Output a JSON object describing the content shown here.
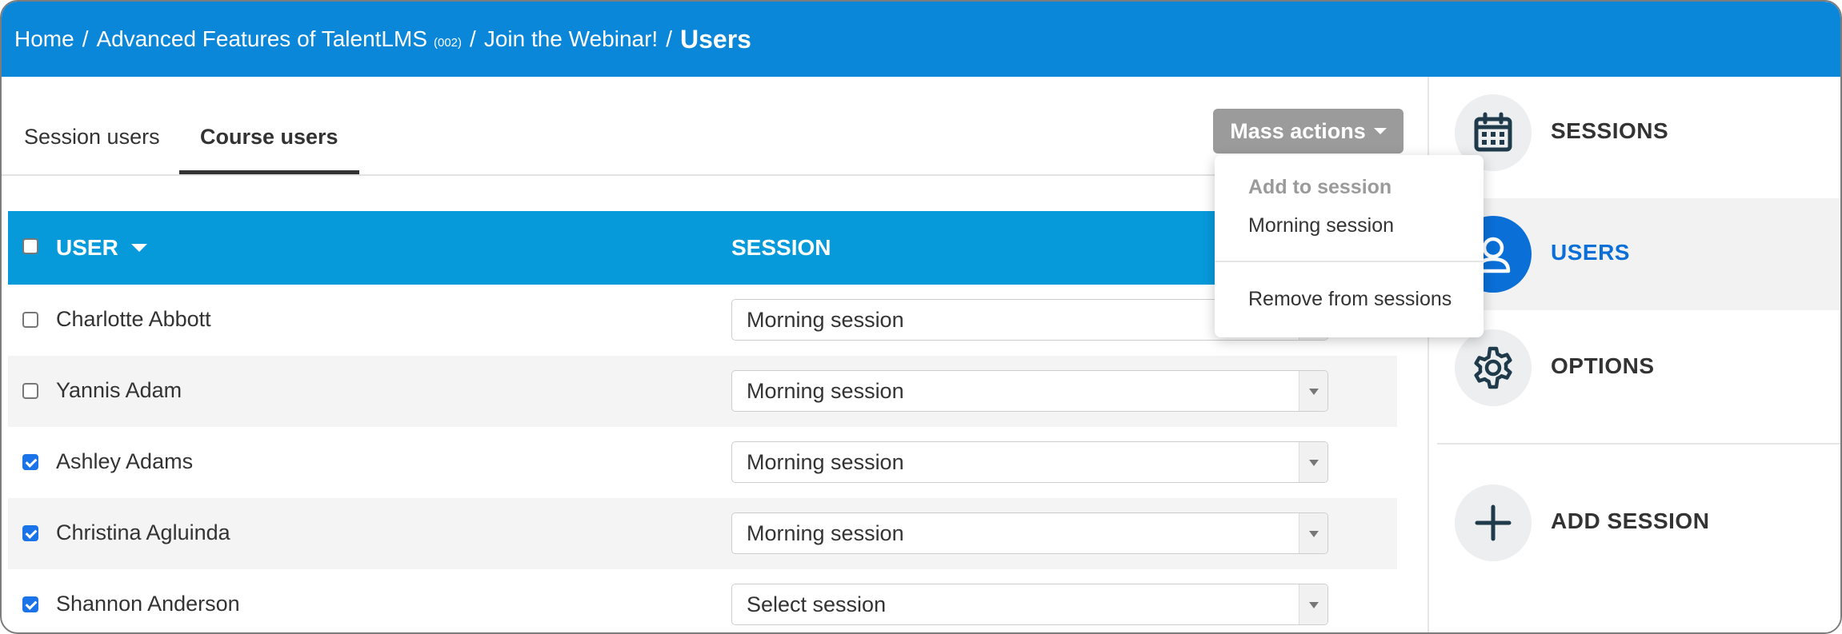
{
  "breadcrumb": {
    "home": "Home",
    "sep": "/",
    "course": "Advanced Features of TalentLMS",
    "course_code": "(002)",
    "unit": "Join the Webinar!",
    "current": "Users"
  },
  "tabs": [
    {
      "label": "Session users",
      "active": false
    },
    {
      "label": "Course users",
      "active": true
    }
  ],
  "mass_actions": {
    "label": "Mass actions",
    "menu": {
      "header": "Add to session",
      "option": "Morning session",
      "remove": "Remove from sessions"
    }
  },
  "table": {
    "columns": {
      "user": "USER",
      "session": "SESSION"
    },
    "rows": [
      {
        "name": "Charlotte Abbott",
        "session": "Morning session",
        "checked": false
      },
      {
        "name": "Yannis Adam",
        "session": "Morning session",
        "checked": false
      },
      {
        "name": "Ashley Adams",
        "session": "Morning session",
        "checked": true
      },
      {
        "name": "Christina Agluinda",
        "session": "Morning session",
        "checked": true
      },
      {
        "name": "Shannon Anderson",
        "session": "Select session",
        "checked": true
      }
    ]
  },
  "sidebar": {
    "items": [
      {
        "label": "SESSIONS",
        "icon": "calendar-icon",
        "active": false
      },
      {
        "label": "USERS",
        "icon": "user-icon",
        "active": true
      },
      {
        "label": "OPTIONS",
        "icon": "gear-icon",
        "active": false
      },
      {
        "label": "ADD SESSION",
        "icon": "plus-icon",
        "active": false
      }
    ]
  },
  "colors": {
    "header": "#0a87d8",
    "table_header": "#069adb",
    "active_accent": "#0a6fd6",
    "mass_button": "#9b9b9b"
  }
}
